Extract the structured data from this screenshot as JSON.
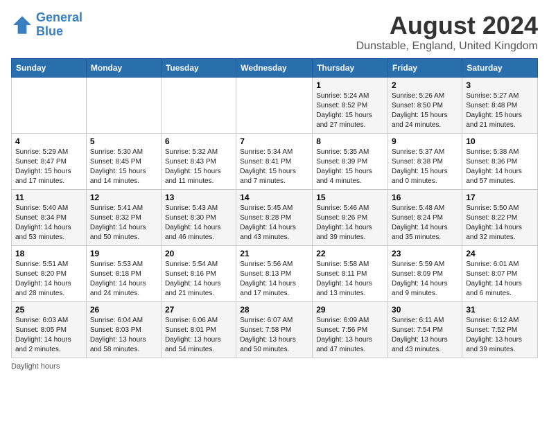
{
  "header": {
    "logo_line1": "General",
    "logo_line2": "Blue",
    "title": "August 2024",
    "subtitle": "Dunstable, England, United Kingdom"
  },
  "weekdays": [
    "Sunday",
    "Monday",
    "Tuesday",
    "Wednesday",
    "Thursday",
    "Friday",
    "Saturday"
  ],
  "weeks": [
    [
      {
        "day": "",
        "content": ""
      },
      {
        "day": "",
        "content": ""
      },
      {
        "day": "",
        "content": ""
      },
      {
        "day": "",
        "content": ""
      },
      {
        "day": "1",
        "content": "Sunrise: 5:24 AM\nSunset: 8:52 PM\nDaylight: 15 hours and 27 minutes."
      },
      {
        "day": "2",
        "content": "Sunrise: 5:26 AM\nSunset: 8:50 PM\nDaylight: 15 hours and 24 minutes."
      },
      {
        "day": "3",
        "content": "Sunrise: 5:27 AM\nSunset: 8:48 PM\nDaylight: 15 hours and 21 minutes."
      }
    ],
    [
      {
        "day": "4",
        "content": "Sunrise: 5:29 AM\nSunset: 8:47 PM\nDaylight: 15 hours and 17 minutes."
      },
      {
        "day": "5",
        "content": "Sunrise: 5:30 AM\nSunset: 8:45 PM\nDaylight: 15 hours and 14 minutes."
      },
      {
        "day": "6",
        "content": "Sunrise: 5:32 AM\nSunset: 8:43 PM\nDaylight: 15 hours and 11 minutes."
      },
      {
        "day": "7",
        "content": "Sunrise: 5:34 AM\nSunset: 8:41 PM\nDaylight: 15 hours and 7 minutes."
      },
      {
        "day": "8",
        "content": "Sunrise: 5:35 AM\nSunset: 8:39 PM\nDaylight: 15 hours and 4 minutes."
      },
      {
        "day": "9",
        "content": "Sunrise: 5:37 AM\nSunset: 8:38 PM\nDaylight: 15 hours and 0 minutes."
      },
      {
        "day": "10",
        "content": "Sunrise: 5:38 AM\nSunset: 8:36 PM\nDaylight: 14 hours and 57 minutes."
      }
    ],
    [
      {
        "day": "11",
        "content": "Sunrise: 5:40 AM\nSunset: 8:34 PM\nDaylight: 14 hours and 53 minutes."
      },
      {
        "day": "12",
        "content": "Sunrise: 5:41 AM\nSunset: 8:32 PM\nDaylight: 14 hours and 50 minutes."
      },
      {
        "day": "13",
        "content": "Sunrise: 5:43 AM\nSunset: 8:30 PM\nDaylight: 14 hours and 46 minutes."
      },
      {
        "day": "14",
        "content": "Sunrise: 5:45 AM\nSunset: 8:28 PM\nDaylight: 14 hours and 43 minutes."
      },
      {
        "day": "15",
        "content": "Sunrise: 5:46 AM\nSunset: 8:26 PM\nDaylight: 14 hours and 39 minutes."
      },
      {
        "day": "16",
        "content": "Sunrise: 5:48 AM\nSunset: 8:24 PM\nDaylight: 14 hours and 35 minutes."
      },
      {
        "day": "17",
        "content": "Sunrise: 5:50 AM\nSunset: 8:22 PM\nDaylight: 14 hours and 32 minutes."
      }
    ],
    [
      {
        "day": "18",
        "content": "Sunrise: 5:51 AM\nSunset: 8:20 PM\nDaylight: 14 hours and 28 minutes."
      },
      {
        "day": "19",
        "content": "Sunrise: 5:53 AM\nSunset: 8:18 PM\nDaylight: 14 hours and 24 minutes."
      },
      {
        "day": "20",
        "content": "Sunrise: 5:54 AM\nSunset: 8:16 PM\nDaylight: 14 hours and 21 minutes."
      },
      {
        "day": "21",
        "content": "Sunrise: 5:56 AM\nSunset: 8:13 PM\nDaylight: 14 hours and 17 minutes."
      },
      {
        "day": "22",
        "content": "Sunrise: 5:58 AM\nSunset: 8:11 PM\nDaylight: 14 hours and 13 minutes."
      },
      {
        "day": "23",
        "content": "Sunrise: 5:59 AM\nSunset: 8:09 PM\nDaylight: 14 hours and 9 minutes."
      },
      {
        "day": "24",
        "content": "Sunrise: 6:01 AM\nSunset: 8:07 PM\nDaylight: 14 hours and 6 minutes."
      }
    ],
    [
      {
        "day": "25",
        "content": "Sunrise: 6:03 AM\nSunset: 8:05 PM\nDaylight: 14 hours and 2 minutes."
      },
      {
        "day": "26",
        "content": "Sunrise: 6:04 AM\nSunset: 8:03 PM\nDaylight: 13 hours and 58 minutes."
      },
      {
        "day": "27",
        "content": "Sunrise: 6:06 AM\nSunset: 8:01 PM\nDaylight: 13 hours and 54 minutes."
      },
      {
        "day": "28",
        "content": "Sunrise: 6:07 AM\nSunset: 7:58 PM\nDaylight: 13 hours and 50 minutes."
      },
      {
        "day": "29",
        "content": "Sunrise: 6:09 AM\nSunset: 7:56 PM\nDaylight: 13 hours and 47 minutes."
      },
      {
        "day": "30",
        "content": "Sunrise: 6:11 AM\nSunset: 7:54 PM\nDaylight: 13 hours and 43 minutes."
      },
      {
        "day": "31",
        "content": "Sunrise: 6:12 AM\nSunset: 7:52 PM\nDaylight: 13 hours and 39 minutes."
      }
    ]
  ],
  "footer": {
    "daylight_label": "Daylight hours"
  }
}
